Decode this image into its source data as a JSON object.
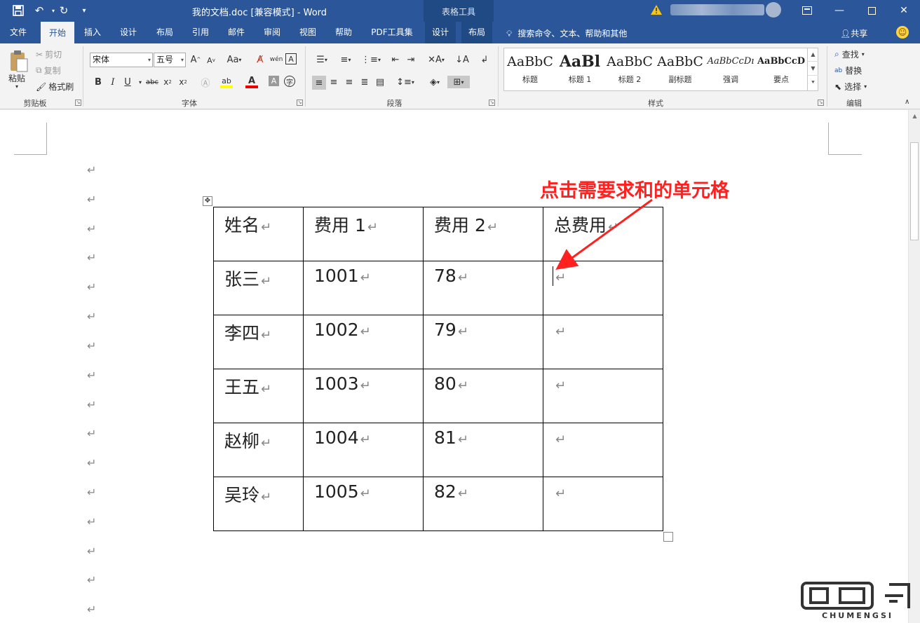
{
  "titlebar": {
    "title": "我的文档.doc [兼容模式] - Word",
    "context_tools": "表格工具",
    "window_controls": [
      "restore-ribbon-icon",
      "minimize-icon",
      "maximize-icon",
      "close-icon"
    ]
  },
  "tabs": {
    "items": [
      "文件",
      "开始",
      "插入",
      "设计",
      "布局",
      "引用",
      "邮件",
      "审阅",
      "视图",
      "帮助",
      "PDF工具集",
      "设计",
      "布局"
    ],
    "active": "开始",
    "search_hint": "搜索命令、文本、帮助和其他",
    "share": "共享"
  },
  "ribbon": {
    "clipboard": {
      "paste": "粘贴",
      "cut": "剪切",
      "copy": "复制",
      "format_painter": "格式刷",
      "label": "剪贴板"
    },
    "font": {
      "font_name": "宋体",
      "font_size": "五号",
      "label": "字体",
      "change_case": "Aa"
    },
    "paragraph": {
      "label": "段落"
    },
    "styles": {
      "label": "样式",
      "items": [
        {
          "sample": "AaBbC",
          "name": "标题"
        },
        {
          "sample": "AaBl",
          "name": "标题 1"
        },
        {
          "sample": "AaBbC",
          "name": "标题 2"
        },
        {
          "sample": "AaBbC",
          "name": "副标题"
        },
        {
          "sample": "AaBbCcDı",
          "name": "强调"
        },
        {
          "sample": "AaBbCcD",
          "name": "要点"
        }
      ]
    },
    "editing": {
      "find": "查找",
      "replace": "替换",
      "select": "选择",
      "label": "编辑"
    }
  },
  "document": {
    "paragraph_mark": "↵",
    "table": {
      "headers": [
        "姓名",
        "费用 1",
        "费用 2",
        "总费用"
      ],
      "rows": [
        [
          "张三",
          "1001",
          "78",
          ""
        ],
        [
          "李四",
          "1002",
          "79",
          ""
        ],
        [
          "王五",
          "1003",
          "80",
          ""
        ],
        [
          "赵柳",
          "1004",
          "81",
          ""
        ],
        [
          "吴玲",
          "1005",
          "82",
          ""
        ]
      ]
    },
    "annotation": "点击需要求和的单元格"
  },
  "colors": {
    "word_blue": "#2b579a",
    "ribbon_bg": "#f3f3f3",
    "annotation_red": "#ff2020"
  },
  "watermark": {
    "text": "CHUMENGSI"
  }
}
